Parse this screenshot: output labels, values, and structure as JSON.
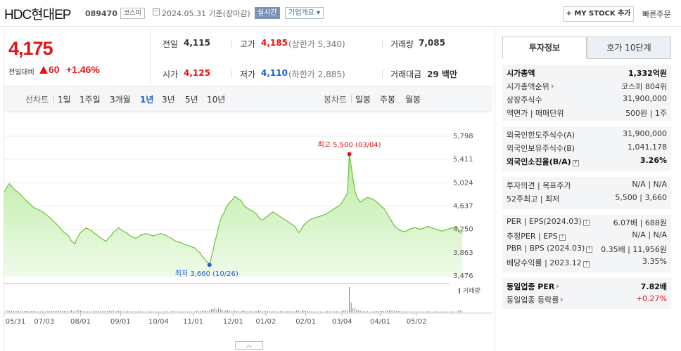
{
  "header": {
    "name": "HDC현대EP",
    "code": "089470",
    "market": "코스피",
    "date": "2024.05.31",
    "date_note": "기준(장마감)",
    "realtime": "실시간",
    "company_overview": "기업개요",
    "mystock_plus": "+",
    "mystock": "MY STOCK 추가",
    "quick_order": "빠른주문"
  },
  "price": {
    "current": "4,175",
    "change_label": "전일대비",
    "change": "60",
    "change_pct": "+1.46%"
  },
  "stats": {
    "prev_label": "전일",
    "prev": "4,115",
    "high_label": "고가",
    "high": "4,185",
    "upper_label": "(상한가",
    "upper": "5,340)",
    "volume_label": "거래량",
    "volume": "7,085",
    "open_label": "시가",
    "open": "4,125",
    "low_label": "저가",
    "low": "4,110",
    "lower_label": "(하한가",
    "lower": "2,885)",
    "amount_label": "거래대금",
    "amount": "29 백만"
  },
  "periods": {
    "line_chart": "선차트",
    "tabs": [
      "1일",
      "1주일",
      "3개월",
      "1년",
      "3년",
      "5년",
      "10년"
    ],
    "active": "1년",
    "candle_chart": "봉차트",
    "candle_tabs": [
      "일봉",
      "주봉",
      "월봉"
    ]
  },
  "chart_data": {
    "type": "area",
    "ylim": [
      3476,
      5798
    ],
    "yticks": [
      "5,798",
      "5,411",
      "5,024",
      "4,637",
      "4,250",
      "3,863",
      "3,476"
    ],
    "xticks": [
      "05/31",
      "07/03",
      "08/01",
      "09/01",
      "10/04",
      "11/01",
      "12/01",
      "01/02",
      "02/01",
      "03/04",
      "04/01",
      "05/02"
    ],
    "x_positions": [
      0,
      22,
      42,
      64,
      85,
      104,
      126,
      144,
      166,
      186,
      207,
      227
    ],
    "n_points": 245,
    "values": [
      4870,
      4920,
      4980,
      5010,
      4970,
      4930,
      4900,
      4880,
      4850,
      4830,
      4790,
      4760,
      4730,
      4700,
      4680,
      4650,
      4620,
      4600,
      4590,
      4570,
      4560,
      4540,
      4520,
      4500,
      4470,
      4450,
      4420,
      4390,
      4360,
      4330,
      4300,
      4260,
      4230,
      4200,
      4180,
      4150,
      4120,
      4050,
      4030,
      4010,
      4100,
      4150,
      4200,
      4220,
      4250,
      4270,
      4260,
      4240,
      4230,
      4200,
      4180,
      4160,
      4130,
      4110,
      4090,
      4070,
      4050,
      4090,
      4130,
      4150,
      4200,
      4220,
      4250,
      4280,
      4250,
      4230,
      4210,
      4200,
      4180,
      4150,
      4130,
      4120,
      4100,
      4110,
      4130,
      4150,
      4160,
      4170,
      4180,
      4170,
      4160,
      4150,
      4140,
      4150,
      4160,
      4170,
      4180,
      4170,
      4160,
      4150,
      4130,
      4120,
      4100,
      4080,
      4060,
      4050,
      4040,
      4030,
      4020,
      4000,
      3990,
      3980,
      3970,
      3960,
      3950,
      3940,
      3900,
      3880,
      3850,
      3800,
      3770,
      3730,
      3700,
      3660,
      3780,
      3900,
      4050,
      4150,
      4300,
      4400,
      4480,
      4520,
      4600,
      4650,
      4700,
      4720,
      4760,
      4800,
      4780,
      4750,
      4740,
      4700,
      4650,
      4620,
      4600,
      4580,
      4560,
      4550,
      4520,
      4500,
      4450,
      4420,
      4400,
      4420,
      4450,
      4470,
      4500,
      4520,
      4540,
      4520,
      4500,
      4480,
      4460,
      4440,
      4420,
      4400,
      4380,
      4360,
      4340,
      4320,
      4300,
      4250,
      4200,
      4220,
      4280,
      4320,
      4350,
      4380,
      4400,
      4420,
      4430,
      4440,
      4450,
      4460,
      4470,
      4480,
      4490,
      4500,
      4520,
      4540,
      4560,
      4580,
      4600,
      4620,
      4640,
      4650,
      4700,
      4750,
      4800,
      4850,
      5500,
      5300,
      5100,
      4900,
      4800,
      4750,
      4700,
      4720,
      4750,
      4760,
      4780,
      4770,
      4760,
      4750,
      4730,
      4700,
      4680,
      4650,
      4620,
      4600,
      4550,
      4500,
      4450,
      4400,
      4350,
      4300,
      4280,
      4250,
      4230,
      4220,
      4210,
      4220,
      4230,
      4250,
      4260,
      4270,
      4280,
      4270,
      4260,
      4250,
      4260,
      4270,
      4280,
      4300,
      4290,
      4280,
      4270,
      4260,
      4250,
      4240,
      4230,
      4220,
      4230,
      4240,
      4250,
      4260,
      4270,
      4280,
      4290,
      4300,
      4250,
      4200,
      4175
    ],
    "max_label": "최고 5,500 (03/04)",
    "min_label": "최저 3,660 (10/26)",
    "volume_label": "거래량"
  },
  "panel": {
    "tab_info": "투자정보",
    "tab_orderbook": "호가 10단계",
    "rows1": [
      {
        "label": "시가총액",
        "value": "1,332억원",
        "bold": true
      },
      {
        "label": "시가총액순위",
        "value": "코스피 804위"
      },
      {
        "label": "상장주식수",
        "value": "31,900,000"
      },
      {
        "label": "액면가 | 매매단위",
        "value": "500원 | 1주"
      }
    ],
    "rows2": [
      {
        "label": "외국인한도주식수(A)",
        "value": "31,900,000"
      },
      {
        "label": "외국인보유주식수(B)",
        "value": "1,041,178"
      },
      {
        "label": "외국인소진율(B/A)",
        "value": "3.26%",
        "bold": true
      }
    ],
    "rows3": [
      {
        "label": "투자의견 | 목표주가",
        "value": "N/A | N/A"
      },
      {
        "label": "52주최고 | 최저",
        "value": "5,500 | 3,660"
      }
    ],
    "rows4": [
      {
        "label": "PER | EPS(2024.03)",
        "value": "6.07배 | 688원"
      },
      {
        "label": "추정PER | EPS",
        "value": "N/A | N/A"
      },
      {
        "label": "PBR | BPS (2024.03)",
        "value": "0.35배 | 11,956원"
      },
      {
        "label": "배당수익률 | 2023.12",
        "value": "3.35%"
      }
    ],
    "rows5": [
      {
        "label": "동일업종 PER",
        "value": "7.82배",
        "bold": true
      },
      {
        "label": "동일업종 등락률",
        "value": "+0.27%",
        "red": true
      }
    ]
  }
}
